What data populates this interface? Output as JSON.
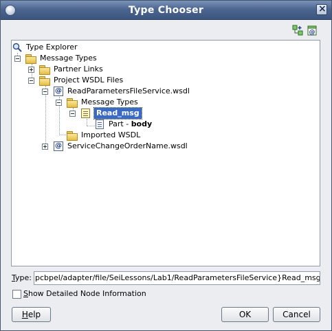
{
  "window": {
    "title": "Type Chooser"
  },
  "tree": {
    "root": "Type Explorer",
    "nodes": {
      "message_types": "Message Types",
      "partner_links": "Partner Links",
      "project_wsdl_files": "Project WSDL Files",
      "read_params_wsdl": "ReadParametersFileService.wsdl",
      "inner_message_types": "Message Types",
      "read_msg": "Read_msg",
      "part_prefix": "Part - ",
      "part_name": "body",
      "imported_wsdl": "Imported WSDL",
      "service_change_wsdl": "ServiceChangeOrderName.wsdl"
    }
  },
  "type_field": {
    "label_mnemonic": "T",
    "label_rest": "ype:",
    "value": "pcbpel/adapter/file/SeiLessons/Lab1/ReadParametersFileService}Read_msg"
  },
  "checkbox": {
    "mnemonic": "S",
    "label_rest": "how Detailed Node Information",
    "checked": false
  },
  "buttons": {
    "help_mnemonic": "H",
    "help_rest": "elp",
    "ok": "OK",
    "cancel": "Cancel"
  },
  "colors": {
    "titlebar": "#4d6690",
    "selection": "#3a6ac4",
    "folder": "#e4bd45"
  }
}
